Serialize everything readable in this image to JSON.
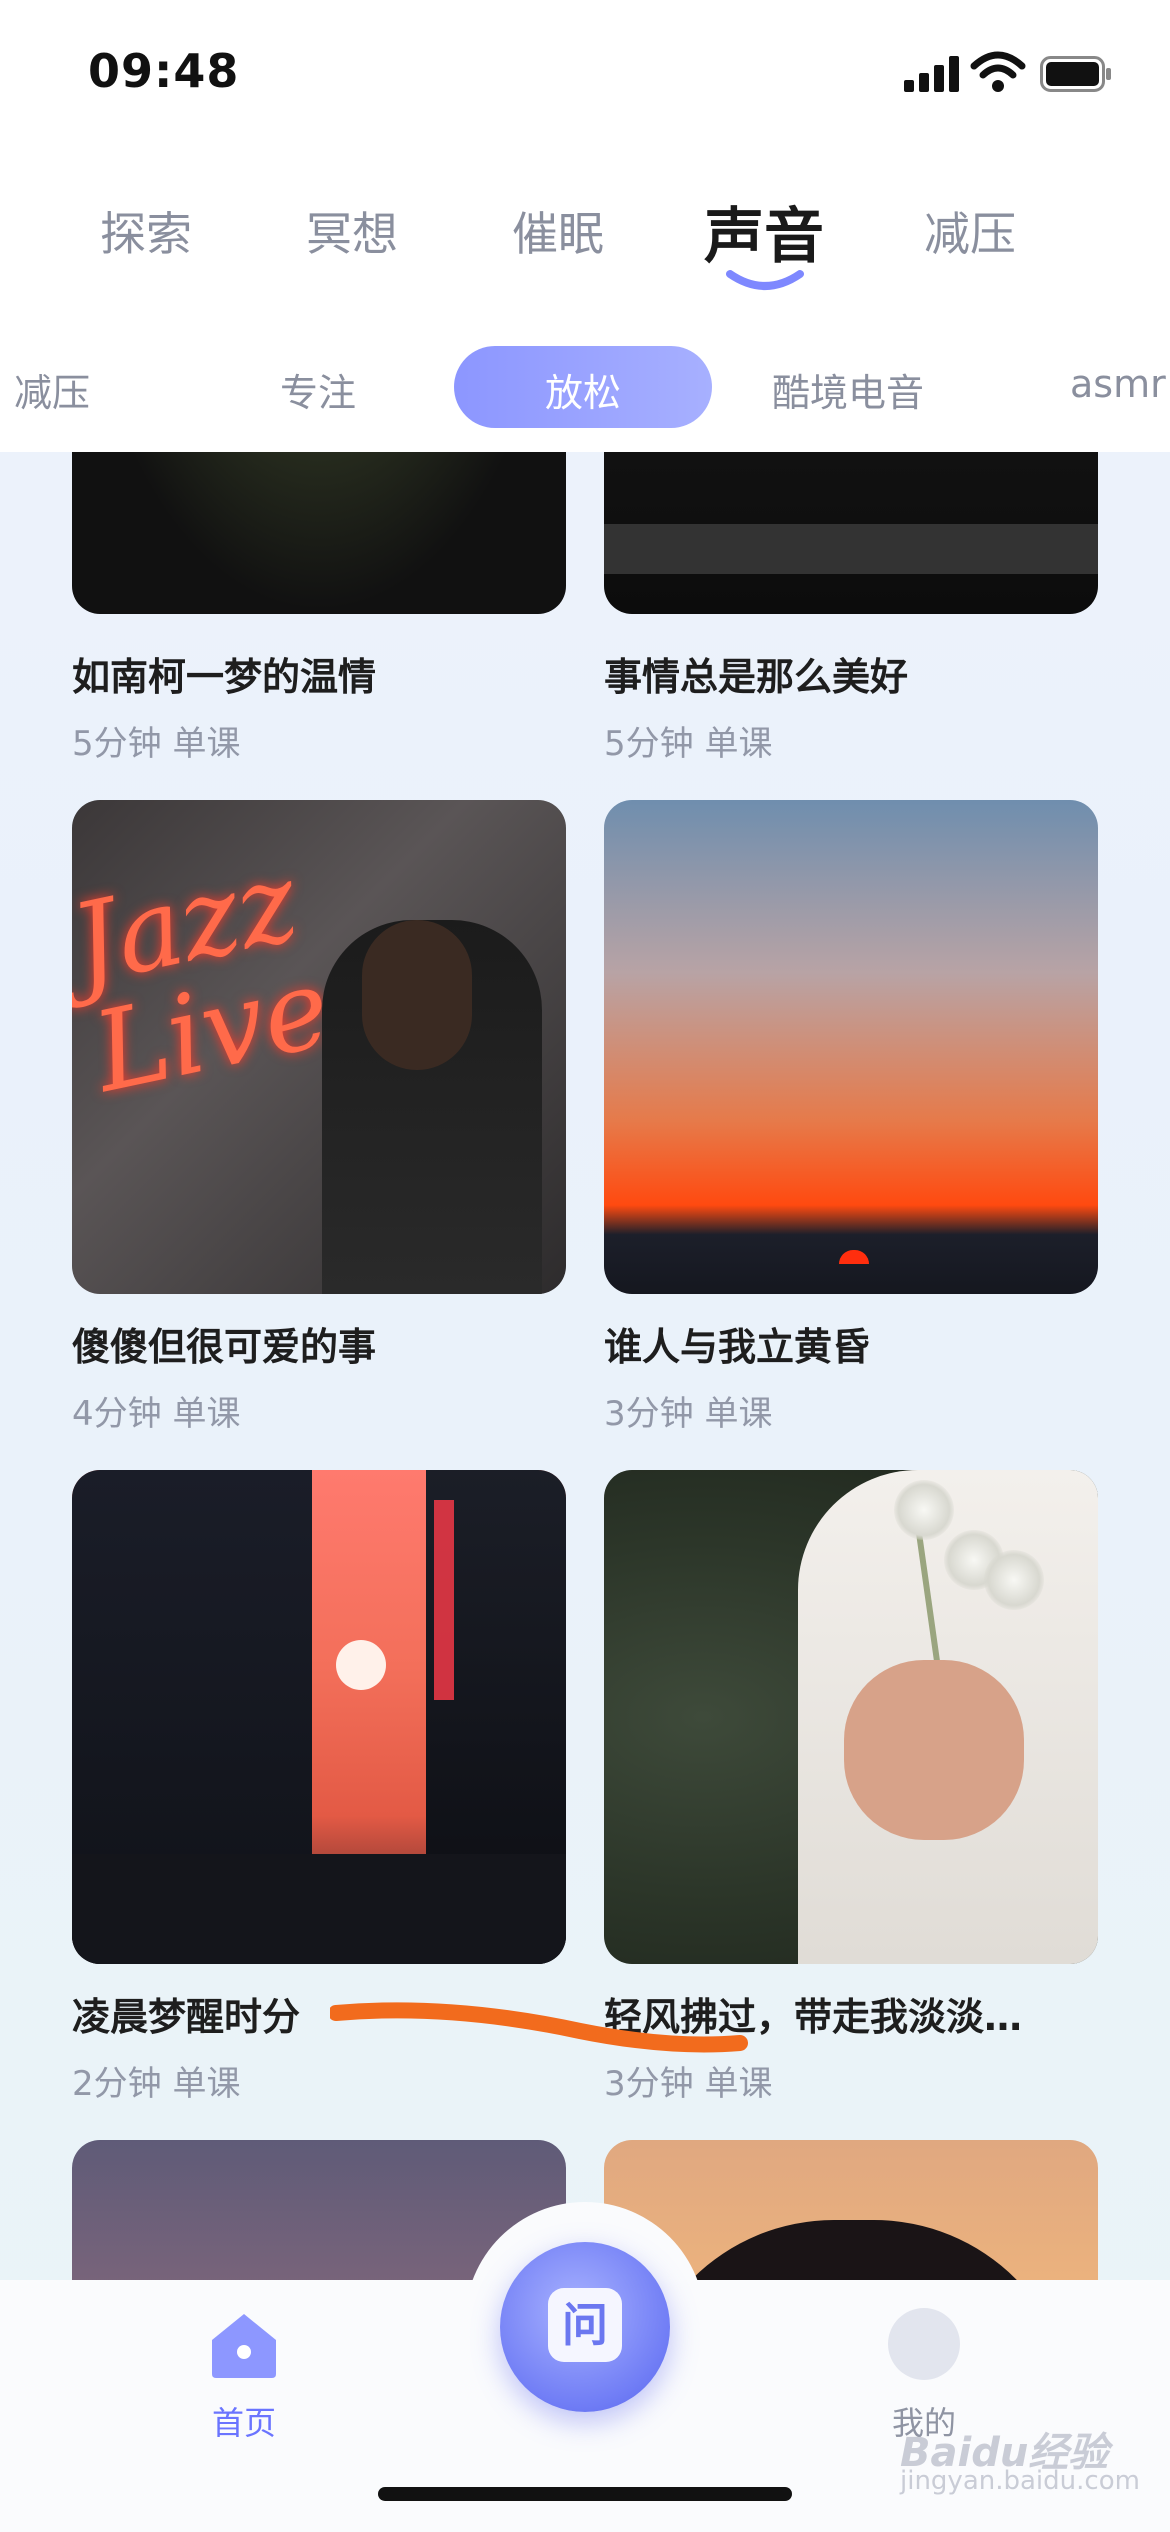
{
  "status_bar": {
    "time": "09:48",
    "icons": [
      "signal-icon",
      "wifi-icon",
      "battery-icon"
    ]
  },
  "main_tabs": [
    {
      "label": "探索",
      "active": false
    },
    {
      "label": "冥想",
      "active": false
    },
    {
      "label": "催眠",
      "active": false
    },
    {
      "label": "声音",
      "active": true
    },
    {
      "label": "减压",
      "active": false
    }
  ],
  "sub_tabs": [
    {
      "label": "减压",
      "active": false
    },
    {
      "label": "专注",
      "active": false
    },
    {
      "label": "放松",
      "active": true
    },
    {
      "label": "酷境电音",
      "active": false
    },
    {
      "label": "asmr",
      "active": false
    }
  ],
  "cards": [
    {
      "title": "如南柯一梦的温情",
      "meta": "5分钟 单课"
    },
    {
      "title": "事情总是那么美好",
      "meta": "5分钟 单课"
    },
    {
      "title": "傻傻但很可爱的事",
      "meta": "4分钟 单课"
    },
    {
      "title": "谁人与我立黄昏",
      "meta": "3分钟 单课"
    },
    {
      "title": "凌晨梦醒时分",
      "meta": "2分钟 单课"
    },
    {
      "title": "轻风拂过，带走我淡淡…",
      "meta": "3分钟 单课"
    }
  ],
  "image_text": {
    "jazz_sign": "Jazz Live"
  },
  "tab_bar": {
    "home_label": "首页",
    "center_label": "问",
    "profile_label": "我的"
  },
  "watermark": {
    "main": "Baidu经验",
    "sub": "jingyan.baidu.com"
  },
  "colors": {
    "accent": "#7e88ff",
    "annotation": "#f26b1d",
    "active_pill_start": "#8c96ff",
    "active_pill_end": "#a7b0ff"
  }
}
